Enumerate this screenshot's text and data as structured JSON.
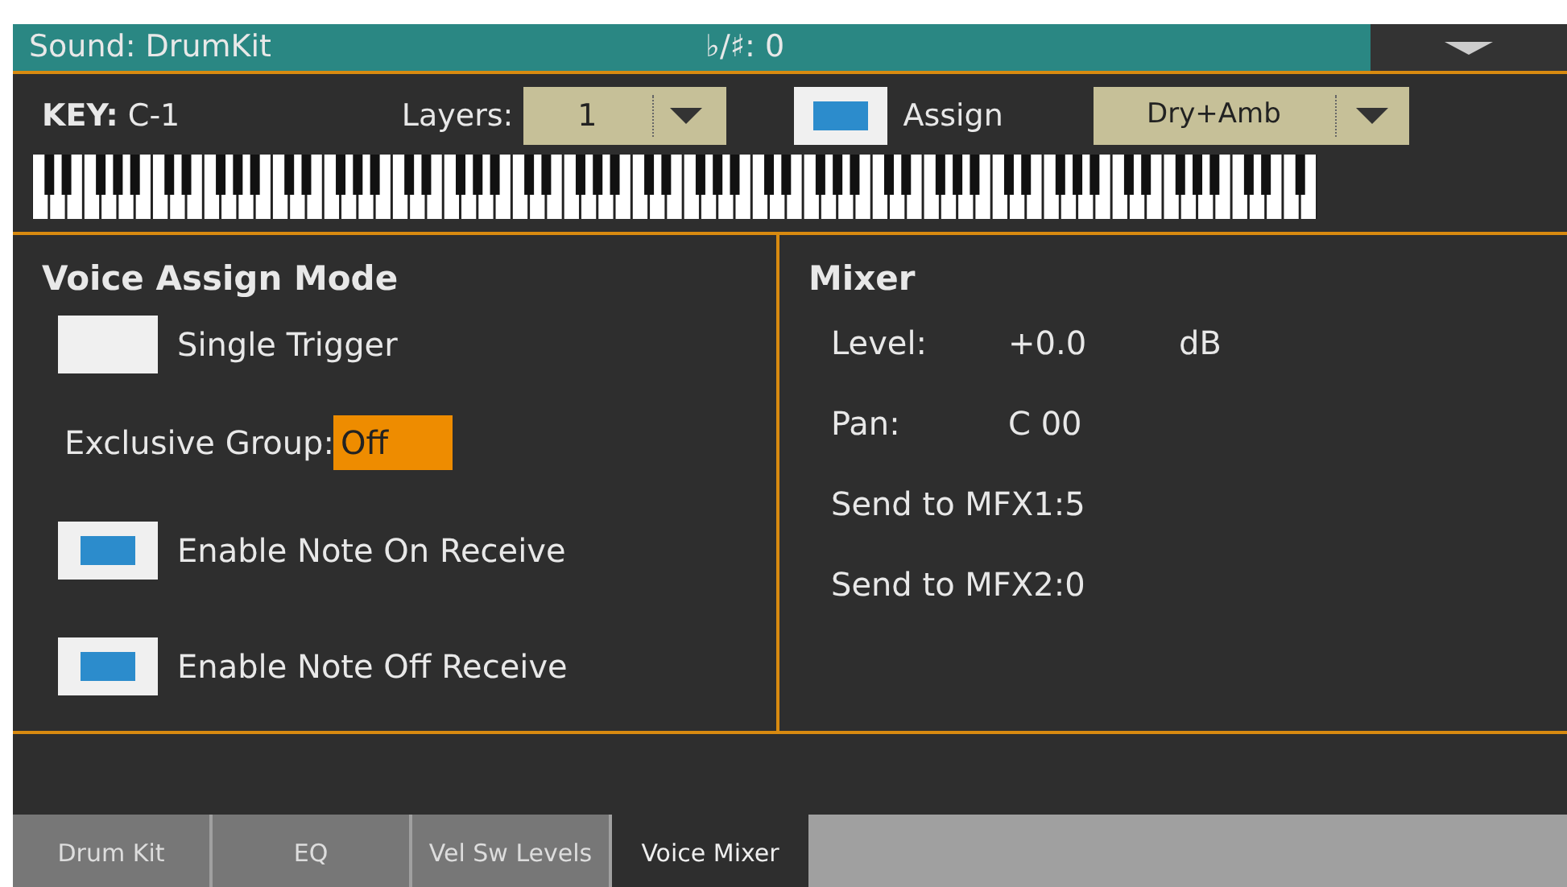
{
  "title_bar": {
    "title": "Sound: DrumKit",
    "transpose": "♭/♯: 0"
  },
  "header": {
    "key_label": "KEY:",
    "key_value": "C-1",
    "layers_label": "Layers:",
    "layers_value": "1",
    "assign": {
      "label": "Assign",
      "checked": true
    },
    "assign_value": "Dry+Amb"
  },
  "voice_assign_mode": {
    "title": "Voice Assign Mode",
    "single_trigger": {
      "label": "Single Trigger",
      "checked": false
    },
    "exclusive_group": {
      "label": "Exclusive Group:",
      "value": "Off"
    },
    "options": [
      {
        "label": "Enable Note On Receive",
        "checked": true
      },
      {
        "label": "Enable Note Off Receive",
        "checked": true
      }
    ]
  },
  "mixer": {
    "title": "Mixer",
    "rows": [
      {
        "label": "Level:",
        "value": "+0.0",
        "unit": "dB"
      },
      {
        "label": "Pan:",
        "value": "C 00"
      },
      {
        "label": "Send to MFX1:5"
      },
      {
        "label": "Send to MFX2:0"
      }
    ]
  },
  "tabs": [
    {
      "label": "Drum Kit",
      "selected": false
    },
    {
      "label": "EQ",
      "selected": false
    },
    {
      "label": "Vel Sw Levels",
      "selected": false
    },
    {
      "label": "Voice Mixer",
      "selected": true
    }
  ]
}
